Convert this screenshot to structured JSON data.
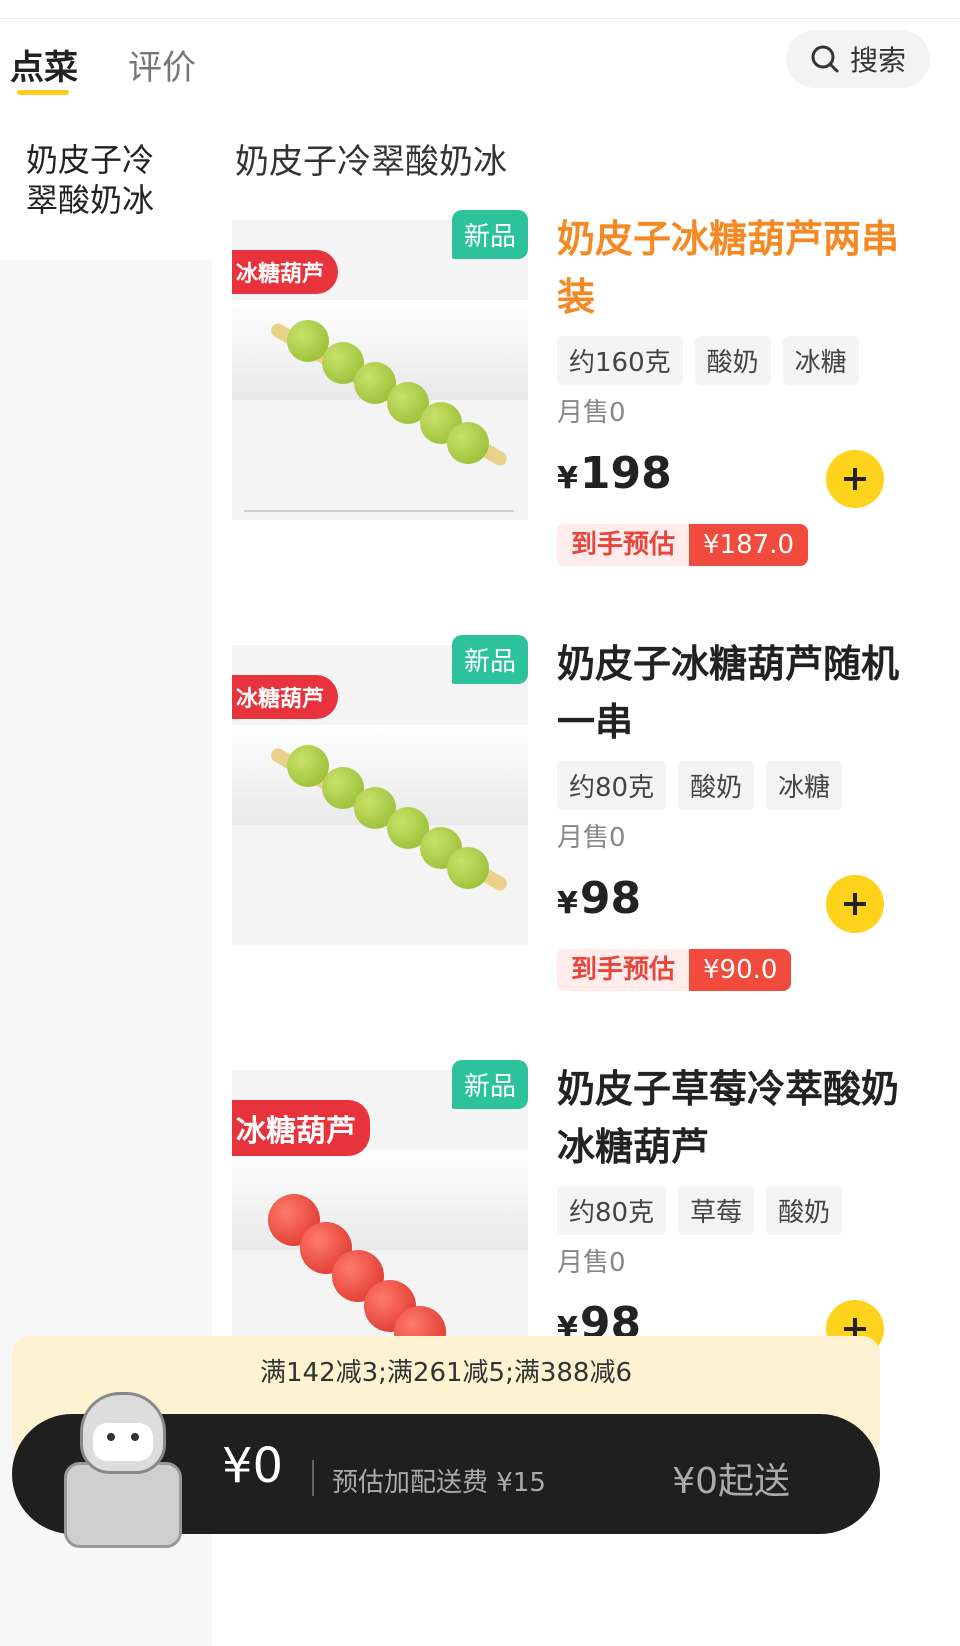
{
  "header": {
    "tabs": [
      {
        "label": "点菜",
        "active": true
      },
      {
        "label": "评价",
        "active": false
      }
    ],
    "search_label": "搜索",
    "accent_color": "#ffcc1f"
  },
  "categories": [
    {
      "label": "奶皮子冷翠酸奶冰",
      "selected": true
    }
  ],
  "section": {
    "title": "奶皮子冷翠酸奶冰"
  },
  "products": [
    {
      "badge": "新品",
      "image_label": "冰糖葫芦",
      "name": "奶皮子冰糖葫芦两串装",
      "tags": [
        "约160克",
        "酸奶",
        "冰糖"
      ],
      "sold": "月售0",
      "currency": "¥",
      "price": "198",
      "estimate_label": "到手预估",
      "estimate_value": "¥187.0"
    },
    {
      "badge": "新品",
      "image_label": "冰糖葫芦",
      "name": "奶皮子冰糖葫芦随机一串",
      "tags": [
        "约80克",
        "酸奶",
        "冰糖"
      ],
      "sold": "月售0",
      "currency": "¥",
      "price": "98",
      "estimate_label": "到手预估",
      "estimate_value": "¥90.0"
    },
    {
      "badge": "新品",
      "image_label": "冰糖葫芦",
      "name": "奶皮子草莓冷萃酸奶冰糖葫芦",
      "tags": [
        "约80克",
        "草莓",
        "酸奶"
      ],
      "sold": "月售0",
      "currency": "¥",
      "price": "98"
    }
  ],
  "cart": {
    "promo": "满142减3;满261减5;满388减6",
    "total": "¥0",
    "delivery_fee": "预估加配送费 ¥15",
    "min_order": "¥0起送"
  }
}
